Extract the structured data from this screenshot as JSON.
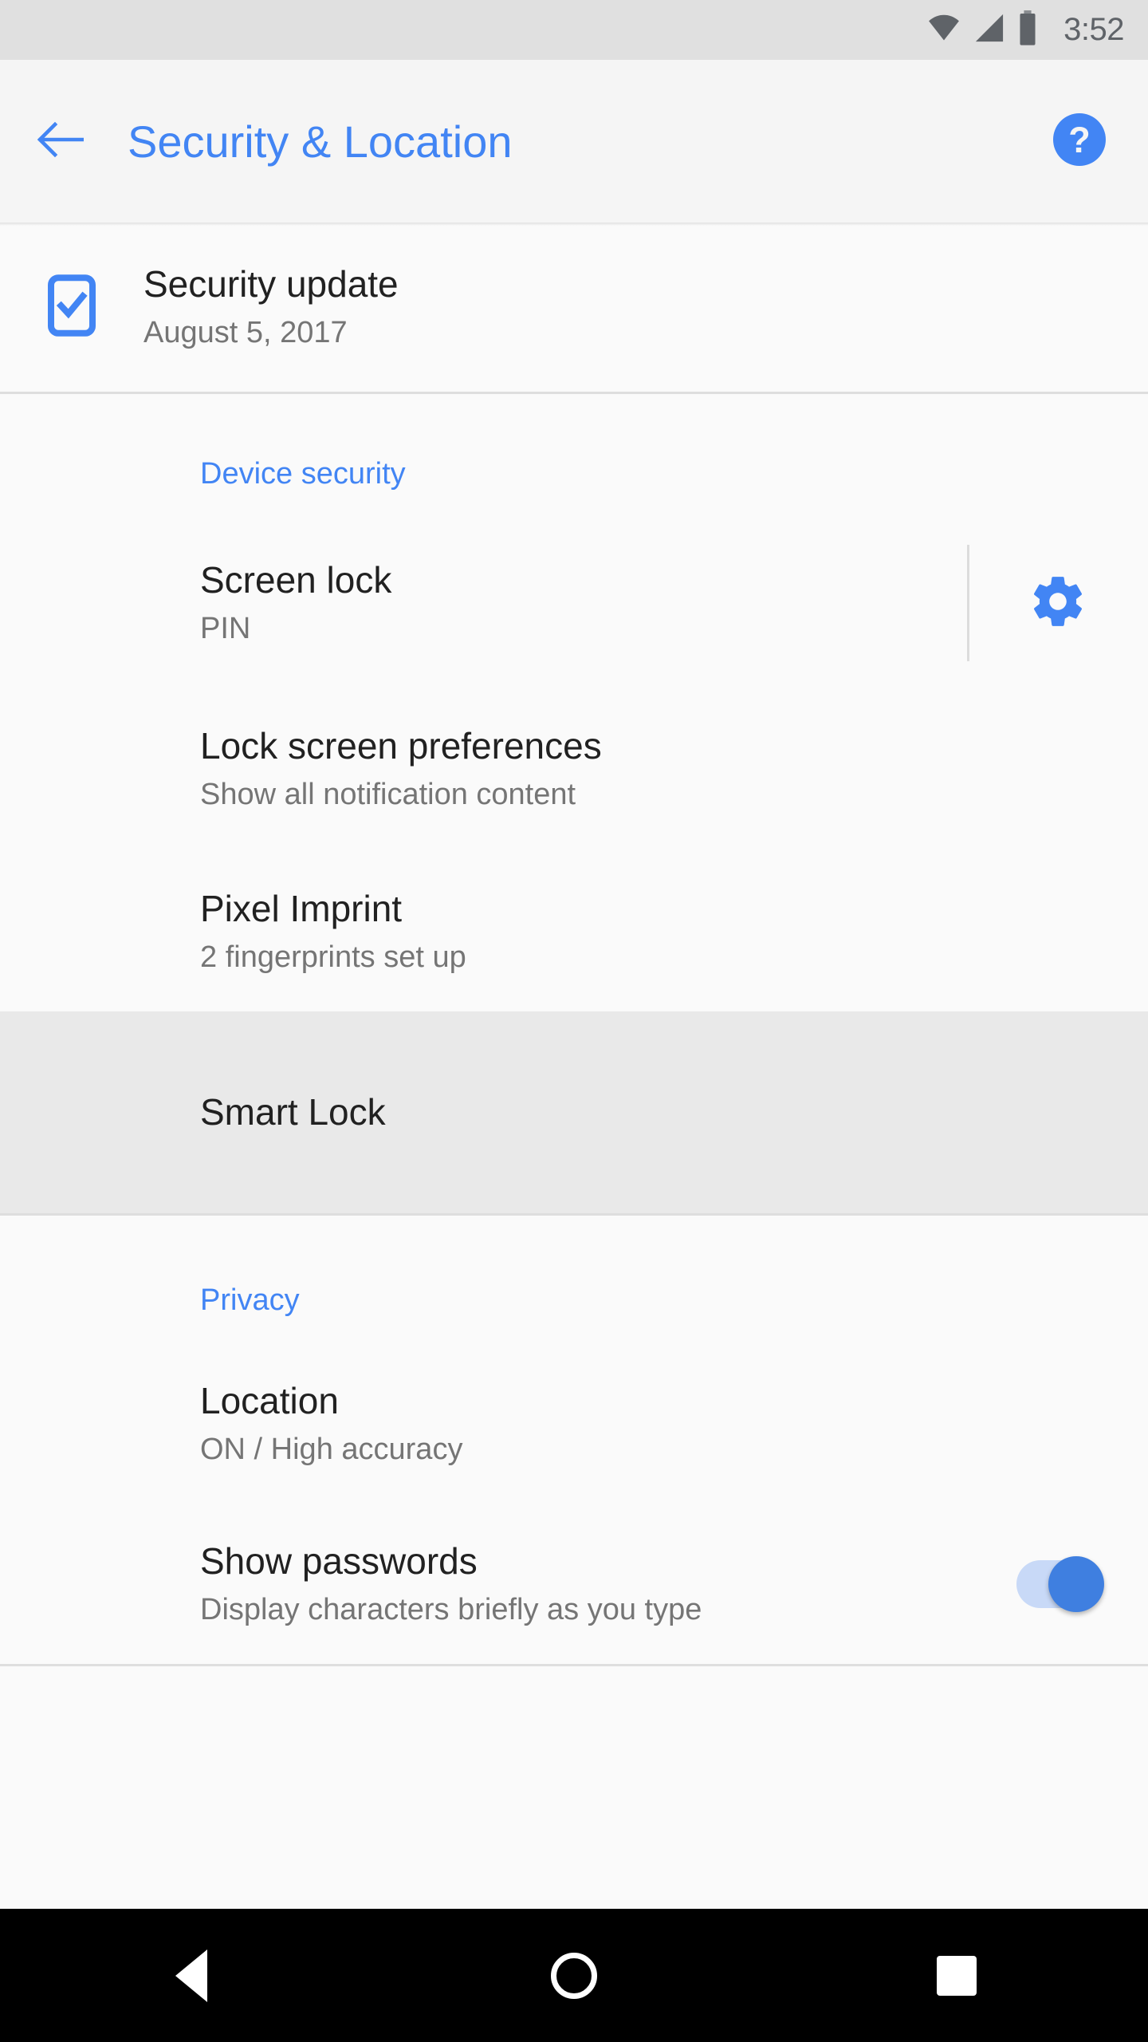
{
  "status_bar": {
    "clock": "3:52",
    "icons": [
      "wifi-icon",
      "cellular-signal-icon",
      "battery-icon"
    ]
  },
  "app_bar": {
    "back_icon": "arrow-back-icon",
    "title": "Security & Location",
    "help_icon": "help-icon",
    "title_color": "#4285f4"
  },
  "content": {
    "security_update": {
      "icon": "phone-check-icon",
      "title": "Security update",
      "subtitle": "August 5, 2017"
    },
    "sections": [
      {
        "header": "Device security",
        "items": [
          {
            "title": "Screen lock",
            "subtitle": "PIN",
            "widget": "gear-icon"
          },
          {
            "title": "Lock screen preferences",
            "subtitle": "Show all notification content",
            "widget": "none"
          },
          {
            "title": "Pixel Imprint",
            "subtitle": "2 fingerprints set up",
            "widget": "none"
          },
          {
            "title": "Smart Lock",
            "subtitle": "",
            "widget": "none",
            "highlighted": true
          }
        ]
      },
      {
        "header": "Privacy",
        "items": [
          {
            "title": "Location",
            "subtitle": "ON / High accuracy",
            "widget": "none"
          },
          {
            "title": "Show passwords",
            "subtitle": "Display characters briefly as you type",
            "widget": "toggle",
            "toggle_on": true
          }
        ]
      }
    ]
  },
  "nav_bar": {
    "back_label": "back-icon",
    "home_label": "home-icon",
    "recents_label": "recents-icon"
  },
  "colors": {
    "accent": "#4285f4",
    "toggle_on": "#3f7fe0",
    "toggle_track": "#c8d9f7",
    "highlight_bg": "#e9e9e9"
  }
}
